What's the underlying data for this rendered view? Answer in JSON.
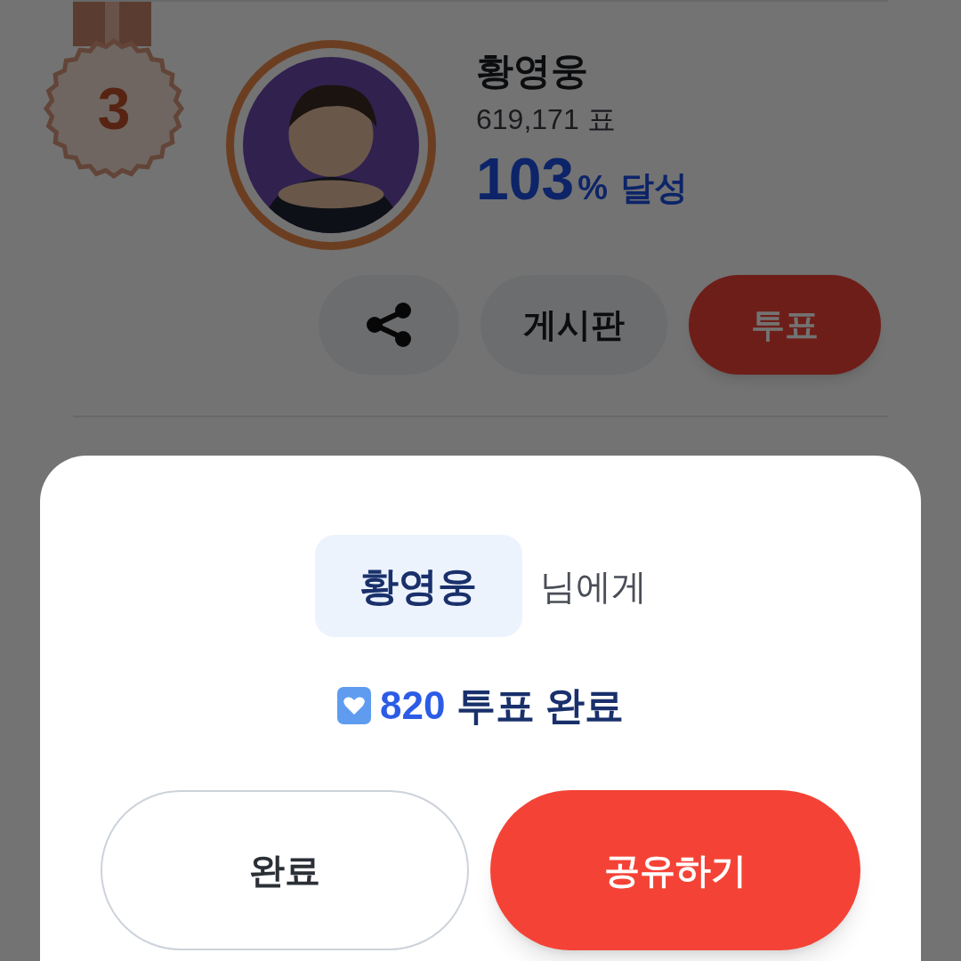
{
  "ranking": {
    "rank": "3",
    "name": "황영웅",
    "votes": "619,171 표",
    "percent": "103",
    "percent_unit": "%",
    "achieved": "달성",
    "buttons": [
      {
        "label": "게시판",
        "kind": "secondary"
      },
      {
        "label": "투표",
        "kind": "primary"
      }
    ]
  },
  "modal": {
    "recipient": "황영웅",
    "suffix": "님에게",
    "count": "820",
    "result": "투표 완료",
    "buttons": [
      {
        "label": "완료",
        "kind": "secondary"
      },
      {
        "label": "공유하기",
        "kind": "primary"
      }
    ]
  }
}
